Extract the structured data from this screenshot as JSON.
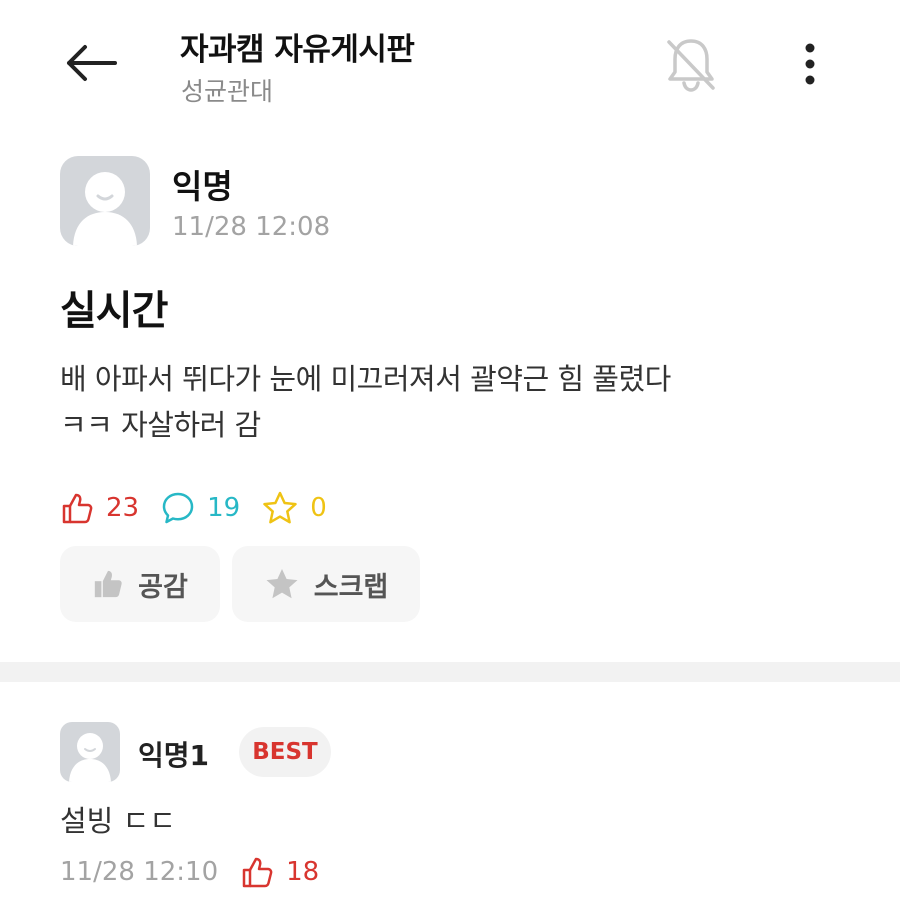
{
  "header": {
    "title": "자과캠 자유게시판",
    "subtitle": "성균관대",
    "icons": {
      "back": "arrow-left-icon",
      "notification": "bell-off-icon",
      "more": "more-vertical-icon"
    }
  },
  "post": {
    "author": "익명",
    "time": "11/28 12:08",
    "title": "실시간",
    "body_lines": [
      "배 아파서 뛰다가 눈에 미끄러져서 괄약근 힘 풀렸다",
      "ㅋㅋ 자살하러 감"
    ],
    "stats": {
      "likes": "23",
      "comments": "19",
      "scraps": "0"
    },
    "actions": {
      "like_label": "공감",
      "scrap_label": "스크랩"
    }
  },
  "comments": [
    {
      "author": "익명1",
      "badge": "BEST",
      "text": "설빙 ㄷㄷ",
      "time": "11/28 12:10",
      "likes": "18"
    }
  ],
  "colors": {
    "like": "#d8352f",
    "comment": "#27b8c6",
    "scrap": "#efc314",
    "muted": "#a3a3a3",
    "avatar_bg": "#d3d6da"
  }
}
